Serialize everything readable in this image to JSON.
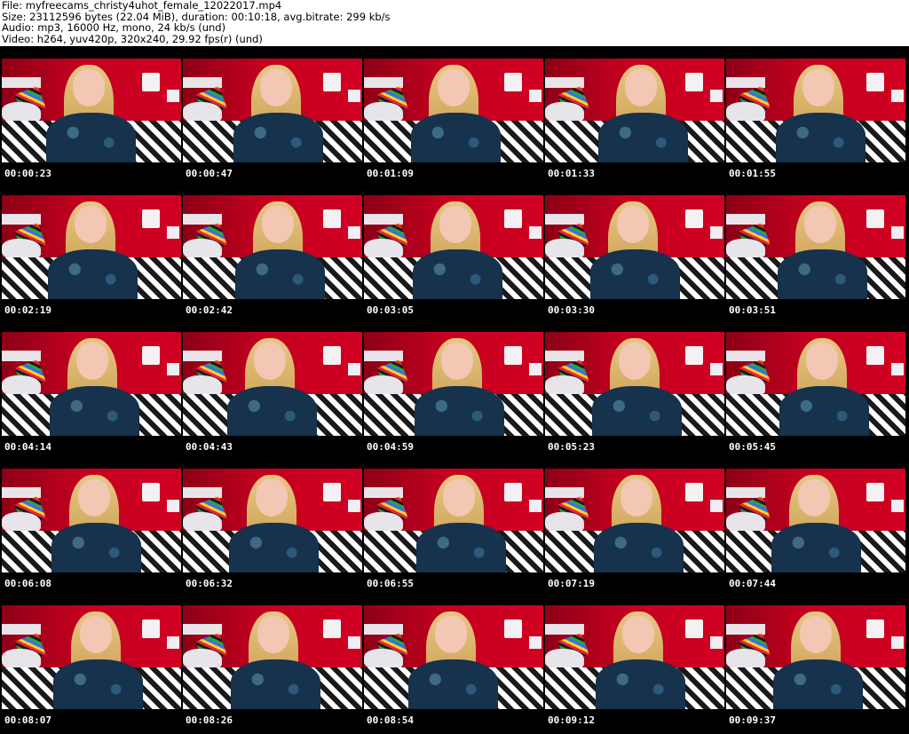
{
  "header": {
    "file_line": "File: myfreecams_christy4uhot_female_12022017.mp4",
    "size_line": "Size: 23112596 bytes (22.04 MiB), duration: 00:10:18, avg.bitrate: 299 kb/s",
    "audio_line": "Audio: mp3, 16000 Hz, mono, 24 kb/s (und)",
    "video_line": "Video: h264, yuv420p, 320x240, 29.92 fps(r) (und)"
  },
  "thumbnails": [
    "00:00:23",
    "00:00:47",
    "00:01:09",
    "00:01:33",
    "00:01:55",
    "00:02:19",
    "00:02:42",
    "00:03:05",
    "00:03:30",
    "00:03:51",
    "00:04:14",
    "00:04:43",
    "00:04:59",
    "00:05:23",
    "00:05:45",
    "00:06:08",
    "00:06:32",
    "00:06:55",
    "00:07:19",
    "00:07:44",
    "00:08:07",
    "00:08:26",
    "00:08:54",
    "00:09:12",
    "00:09:37"
  ],
  "colors": {
    "background": "#000000",
    "header_bg": "#ffffff",
    "timestamp_text": "#ffffff"
  }
}
